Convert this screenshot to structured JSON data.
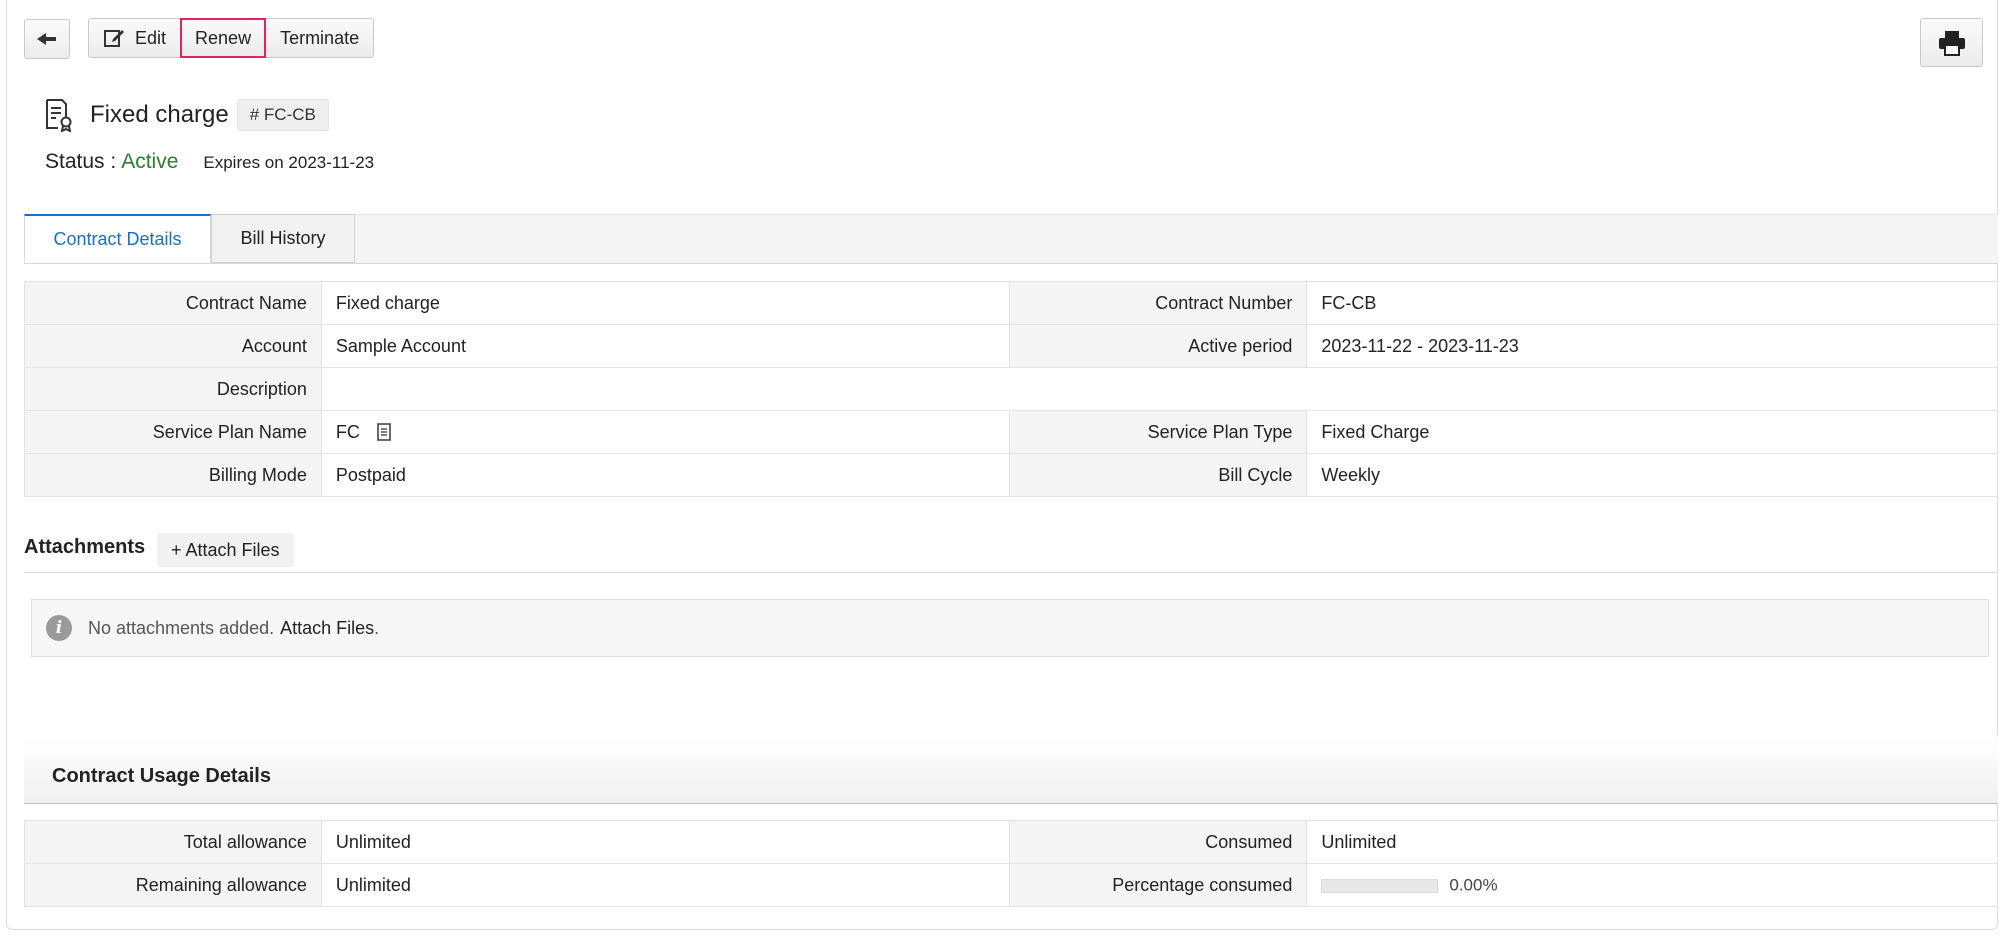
{
  "toolbar": {
    "back_icon": "arrow-left-icon",
    "edit_label": "Edit",
    "edit_icon": "edit-icon",
    "renew_label": "Renew",
    "terminate_label": "Terminate",
    "print_icon": "printer-icon"
  },
  "header": {
    "icon": "contract-certificate-icon",
    "title": "Fixed charge",
    "badge": "# FC-CB",
    "status_label": "Status :",
    "status_value": "Active",
    "status_color": "#2e7d32",
    "expires": "Expires on 2023-11-23"
  },
  "tabs": [
    {
      "label": "Contract Details",
      "active": true
    },
    {
      "label": "Bill History",
      "active": false
    }
  ],
  "details": {
    "contract_name_label": "Contract Name",
    "contract_name": "Fixed charge",
    "contract_number_label": "Contract Number",
    "contract_number": "FC-CB",
    "account_label": "Account",
    "account": "Sample Account",
    "active_period_label": "Active period",
    "active_period": "2023-11-22 - 2023-11-23",
    "description_label": "Description",
    "description": "",
    "service_plan_name_label": "Service Plan Name",
    "service_plan_name": "FC",
    "service_plan_type_label": "Service Plan Type",
    "service_plan_type": "Fixed Charge",
    "billing_mode_label": "Billing Mode",
    "billing_mode": "Postpaid",
    "bill_cycle_label": "Bill Cycle",
    "bill_cycle": "Weekly"
  },
  "attachments": {
    "title": "Attachments",
    "attach_button": "+ Attach Files",
    "empty_text": "No attachments added.",
    "empty_link": "Attach Files",
    "empty_suffix": "."
  },
  "usage": {
    "title": "Contract Usage Details",
    "total_allowance_label": "Total allowance",
    "total_allowance": "Unlimited",
    "consumed_label": "Consumed",
    "consumed": "Unlimited",
    "remaining_allowance_label": "Remaining allowance",
    "remaining_allowance": "Unlimited",
    "percentage_consumed_label": "Percentage consumed",
    "percentage_consumed": "0.00%",
    "percentage_value": 0.0
  }
}
